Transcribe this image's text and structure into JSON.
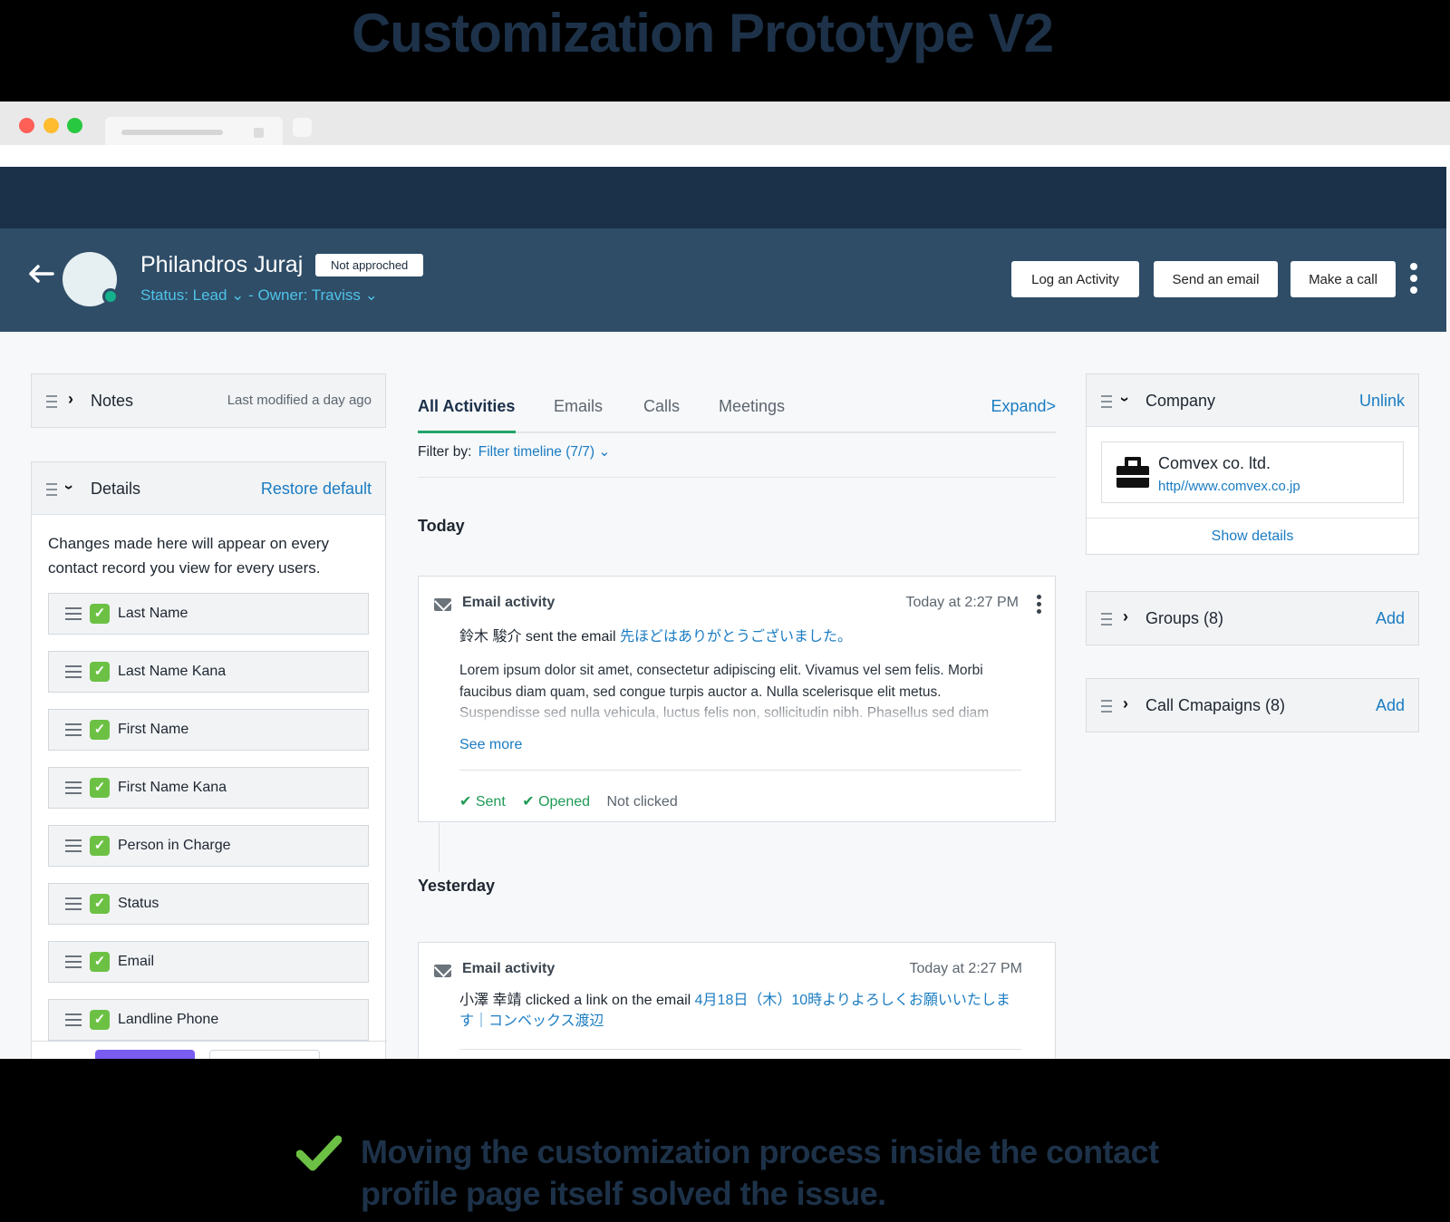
{
  "hero": {
    "title": "Customization Prototype  V2"
  },
  "profile": {
    "back_icon": "arrow-left-icon",
    "name": "Philandros Juraj",
    "badge": "Not approched",
    "status": "Status: Lead ⌄  - Owner: Traviss ⌄",
    "buttons": {
      "log": "Log an Activity",
      "email": "Send an email",
      "call": "Make a call"
    }
  },
  "notes": {
    "title": "Notes",
    "meta": "Last modified a day ago"
  },
  "details": {
    "title": "Details",
    "action": "Restore default",
    "description": "Changes made here will appear on every contact record you view for every users.",
    "fields": [
      "Last Name",
      "Last Name Kana",
      "First Name",
      "First Name Kana",
      "Person in Charge",
      "Status",
      "Email",
      "Landline Phone"
    ]
  },
  "activities": {
    "tabs": [
      "All Activities",
      "Emails",
      "Calls",
      "Meetings"
    ],
    "expand": "Expand>",
    "filter_label": "Filter by:",
    "filter_value": "Filter timeline (7/7) ⌄",
    "today_label": "Today",
    "yesterday_label": "Yesterday",
    "item1": {
      "type": "Email activity",
      "time": "Today at 2:27 PM",
      "actor": "鈴木 駿介 sent the email ",
      "subject": "先ほどはありがとうございました。",
      "body": "Lorem ipsum dolor sit amet, consectetur adipiscing elit. Vivamus vel sem felis. Morbi faucibus diam quam, sed congue turpis auctor a. Nulla scelerisque elit metus. Suspendisse sed nulla vehicula, luctus felis non, sollicitudin nibh. Phasellus sed diam",
      "see_more": "See more",
      "status_sent": "✔ Sent",
      "status_opened": "✔ Opened",
      "status_clicked": "Not clicked"
    },
    "item2": {
      "type": "Email activity",
      "time": "Today at 2:27 PM",
      "actor": "小澤 幸靖 clicked a link on the email ",
      "subject": "4月18日（木）10時よりよろしくお願いいたします｜コンベックス渡辺"
    }
  },
  "company": {
    "title": "Company",
    "action": "Unlink",
    "name": "Comvex co. ltd.",
    "url": "http//www.comvex.co.jp",
    "show_details": "Show details"
  },
  "groups": {
    "title": "Groups (8)",
    "action": "Add"
  },
  "campaigns": {
    "title": "Call Cmapaigns (8)",
    "action": "Add"
  },
  "footer": {
    "check_icon": "check-icon",
    "text": "Moving the customization process inside the contact profile page itself solved the issue."
  }
}
